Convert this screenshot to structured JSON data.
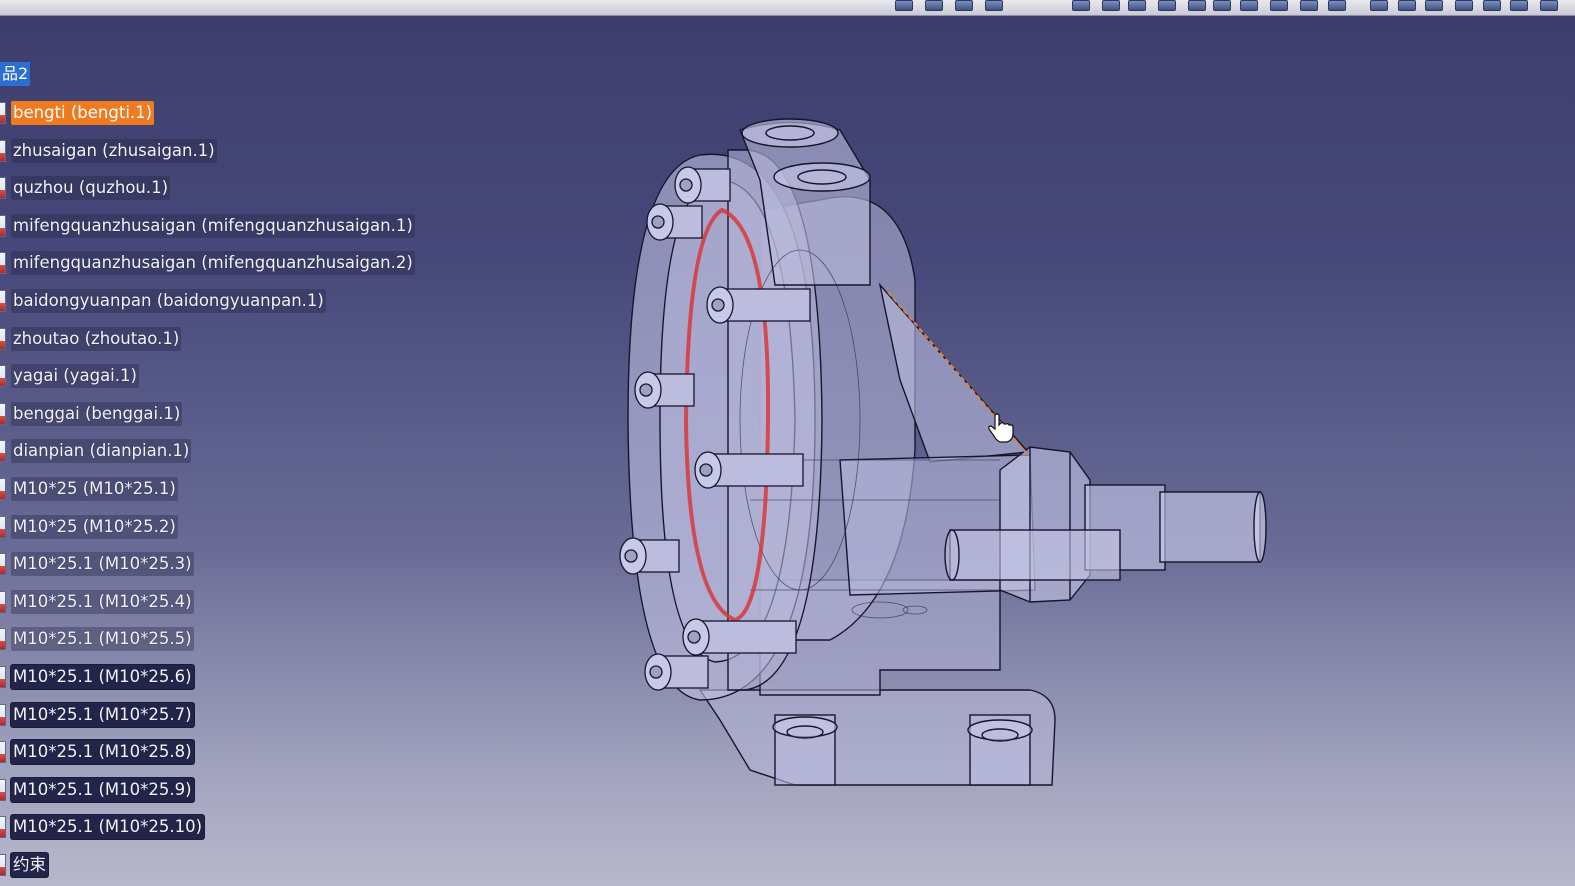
{
  "toolbar": {
    "icons": [
      "toolbar-icon",
      "toolbar-icon",
      "toolbar-icon",
      "toolbar-icon",
      "toolbar-icon",
      "toolbar-icon",
      "toolbar-icon",
      "toolbar-icon",
      "toolbar-icon",
      "toolbar-icon",
      "toolbar-icon",
      "toolbar-icon",
      "toolbar-icon",
      "toolbar-icon",
      "toolbar-icon",
      "toolbar-icon",
      "toolbar-icon",
      "toolbar-icon",
      "toolbar-icon",
      "toolbar-icon",
      "toolbar-icon"
    ]
  },
  "tree": {
    "root_label": "品2",
    "nodes": [
      {
        "label": "bengti (bengti.1)",
        "style": "selected"
      },
      {
        "label": "zhusaigan (zhusaigan.1)",
        "style": "plain"
      },
      {
        "label": "quzhou (quzhou.1)",
        "style": "plain"
      },
      {
        "label": "mifengquanzhusaigan (mifengquanzhusaigan.1)",
        "style": "plain"
      },
      {
        "label": "mifengquanzhusaigan (mifengquanzhusaigan.2)",
        "style": "plain"
      },
      {
        "label": "baidongyuanpan (baidongyuanpan.1)",
        "style": "plain"
      },
      {
        "label": "zhoutao (zhoutao.1)",
        "style": "plain"
      },
      {
        "label": "yagai (yagai.1)",
        "style": "plain"
      },
      {
        "label": "benggai (benggai.1)",
        "style": "plain"
      },
      {
        "label": "dianpian (dianpian.1)",
        "style": "plain"
      },
      {
        "label": "M10*25 (M10*25.1)",
        "style": "plain"
      },
      {
        "label": "M10*25 (M10*25.2)",
        "style": "plain"
      },
      {
        "label": "M10*25.1 (M10*25.3)",
        "style": "plain"
      },
      {
        "label": "M10*25.1 (M10*25.4)",
        "style": "plain"
      },
      {
        "label": "M10*25.1 (M10*25.5)",
        "style": "plain"
      },
      {
        "label": "M10*25.1 (M10*25.6)",
        "style": "dark"
      },
      {
        "label": "M10*25.1 (M10*25.7)",
        "style": "dark"
      },
      {
        "label": "M10*25.1 (M10*25.8)",
        "style": "dark"
      },
      {
        "label": "M10*25.1 (M10*25.9)",
        "style": "dark"
      },
      {
        "label": "M10*25.1 (M10*25.10)",
        "style": "dark"
      },
      {
        "label": "约束",
        "style": "dark"
      }
    ]
  },
  "viewport": {
    "model": "pump-assembly-3d-model",
    "colors": {
      "body": "#b9b9dc",
      "edge": "#15152c",
      "seal": "#d8383a",
      "highlight": "#e0863a"
    }
  },
  "cursor": {
    "icon": "hand-cursor-icon"
  }
}
